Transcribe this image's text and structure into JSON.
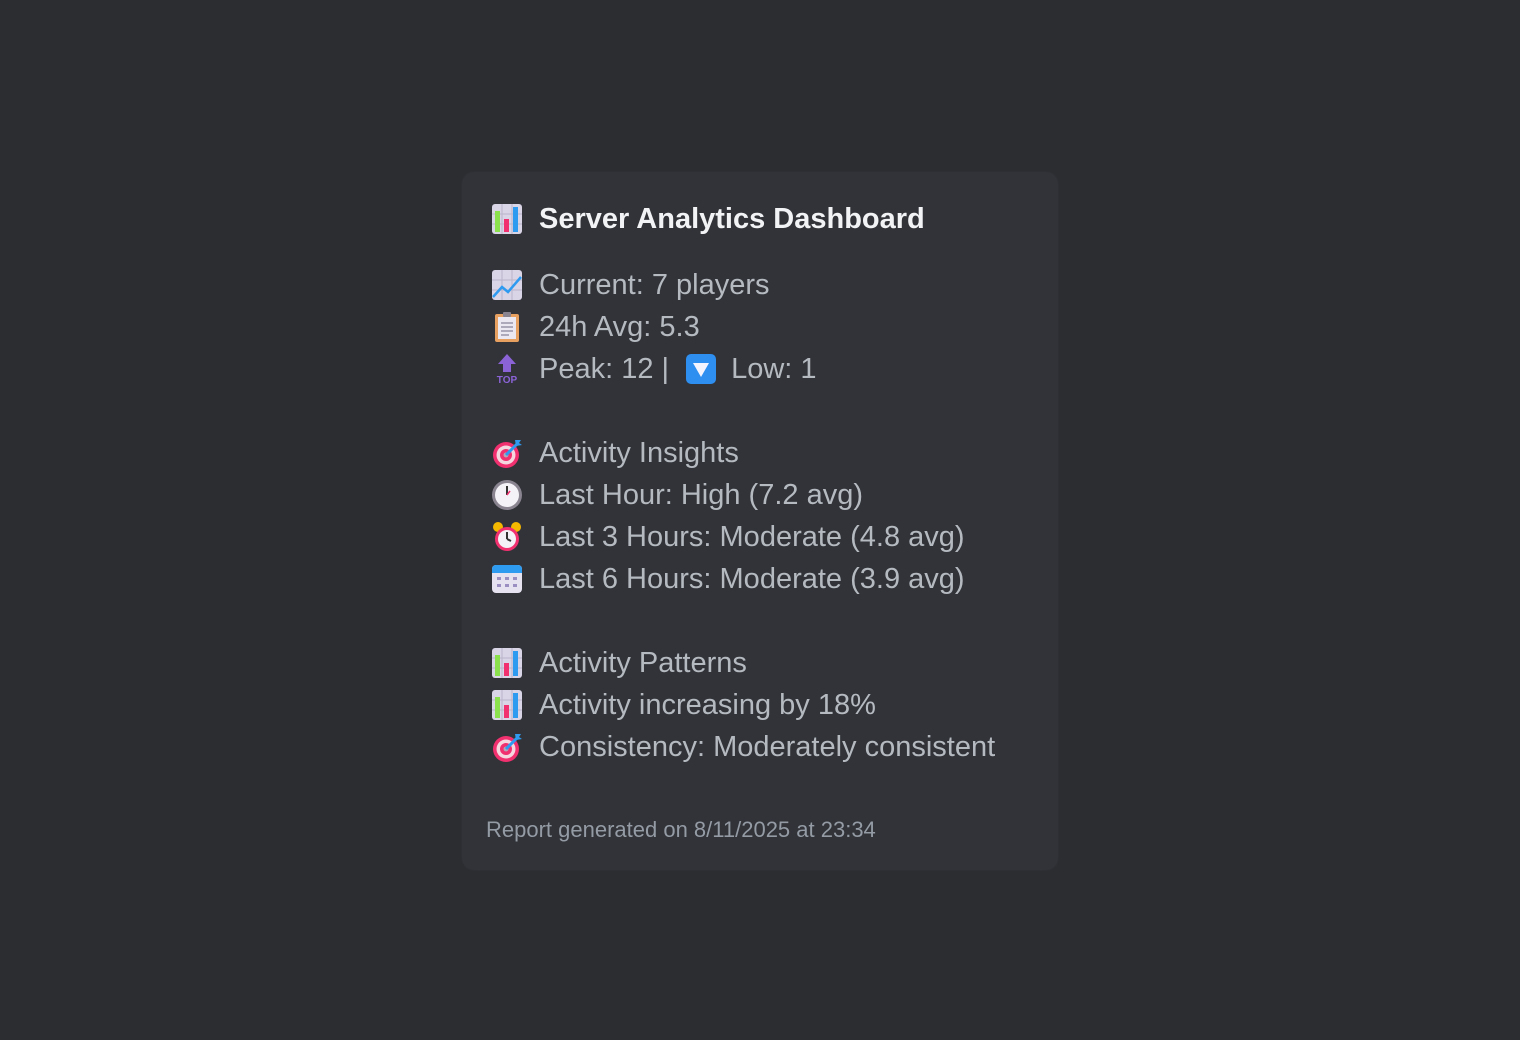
{
  "title": "Server Analytics Dashboard",
  "stats": {
    "current": "Current: 7 players",
    "avg": "24h Avg: 5.3",
    "peak": "Peak: 12 |",
    "low": "Low: 1"
  },
  "insights": {
    "heading": "Activity Insights",
    "items": [
      "Last Hour: High (7.2 avg)",
      "Last 3 Hours: Moderate (4.8 avg)",
      "Last 6 Hours: Moderate (3.9 avg)"
    ]
  },
  "patterns": {
    "heading": "Activity Patterns",
    "items": [
      "Activity increasing by 18%",
      "Consistency: Moderately consistent"
    ]
  },
  "footer": "Report generated on 8/11/2025 at 23:34",
  "icons": {
    "title": "bar-chart-icon",
    "current": "chart-increasing-icon",
    "avg": "clipboard-icon",
    "peak": "top-arrow-icon",
    "low": "down-button-icon",
    "insights": "target-icon",
    "hour": "clock-icon",
    "three_hours": "alarm-clock-icon",
    "six_hours": "calendar-icon"
  }
}
